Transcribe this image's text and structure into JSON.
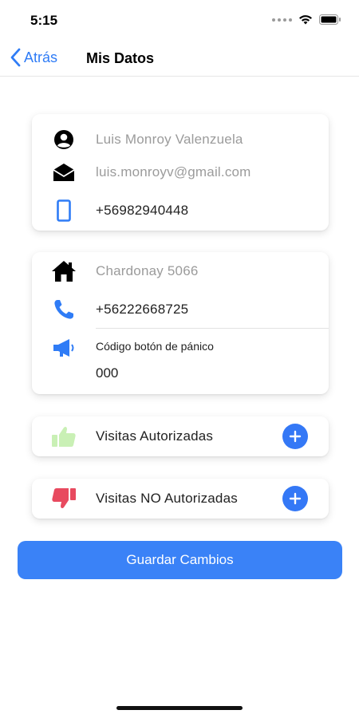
{
  "status_bar": {
    "time": "5:15"
  },
  "nav": {
    "back_label": "Atrás",
    "title": "Mis Datos"
  },
  "personal": {
    "name": "Luis Monroy Valenzuela",
    "email": "luis.monroyv@gmail.com",
    "phone": "+56982940448"
  },
  "address": {
    "street": "Chardonay 5066",
    "phone": "+56222668725",
    "panic_label": "Código botón de pánico",
    "panic_code": "000"
  },
  "visits": {
    "authorized_label": "Visitas Autorizadas",
    "unauthorized_label": "Visitas NO Autorizadas"
  },
  "actions": {
    "save_label": "Guardar Cambios"
  },
  "colors": {
    "accent": "#3478f6",
    "thumb_up": "#c9f0b5",
    "thumb_down": "#e84a5f"
  }
}
